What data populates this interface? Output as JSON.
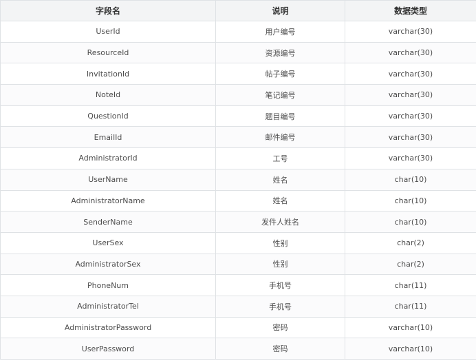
{
  "table": {
    "headers": [
      "字段名",
      "说明",
      "数据类型"
    ],
    "rows": [
      [
        "UserId",
        "用户编号",
        "varchar(30)"
      ],
      [
        "ResourceId",
        "资源编号",
        "varchar(30)"
      ],
      [
        "InvitationId",
        "帖子编号",
        "varchar(30)"
      ],
      [
        "NoteId",
        "笔记编号",
        "varchar(30)"
      ],
      [
        "QuestionId",
        "题目编号",
        "varchar(30)"
      ],
      [
        "EmailId",
        "邮件编号",
        "varchar(30)"
      ],
      [
        "AdministratorId",
        "工号",
        "varchar(30)"
      ],
      [
        "UserName",
        "姓名",
        "char(10)"
      ],
      [
        "AdministratorName",
        "姓名",
        "char(10)"
      ],
      [
        "SenderName",
        "发件人姓名",
        "char(10)"
      ],
      [
        "UserSex",
        "性别",
        "char(2)"
      ],
      [
        "AdministratorSex",
        "性别",
        "char(2)"
      ],
      [
        "PhoneNum",
        "手机号",
        "char(11)"
      ],
      [
        "AdministratorTel",
        "手机号",
        "char(11)"
      ],
      [
        "AdministratorPassword",
        "密码",
        "varchar(10)"
      ],
      [
        "UserPassword",
        "密码",
        "varchar(10)"
      ]
    ]
  }
}
